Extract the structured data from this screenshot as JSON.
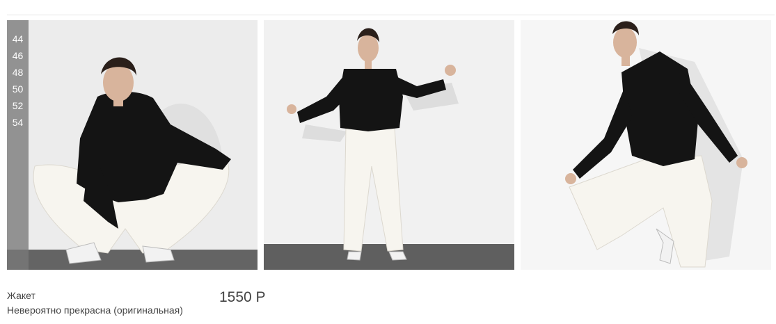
{
  "product": {
    "type_label": "Жакет",
    "name": "Невероятно прекрасна (оригинальная)",
    "price": "1550 Р",
    "sizes": [
      "44",
      "46",
      "48",
      "50",
      "52",
      "54"
    ],
    "photos": [
      {
        "description_icon": "product-photo-crouching"
      },
      {
        "description_icon": "product-photo-standing"
      },
      {
        "description_icon": "product-photo-leaning"
      }
    ]
  },
  "colors": {
    "jacket": "#141414",
    "trousers": "#f4f2ec",
    "wall": "#eeeeee",
    "floor": "#6b6b6b",
    "size_strip": "#7a7a7a"
  }
}
